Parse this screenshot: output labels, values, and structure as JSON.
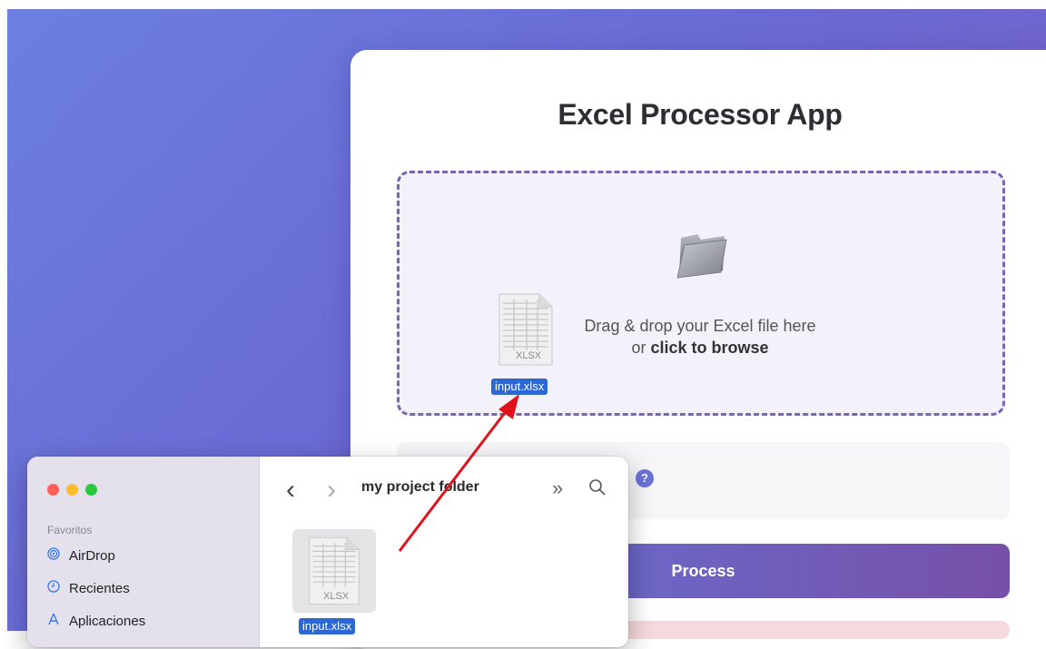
{
  "app": {
    "title": "Excel Processor App",
    "drop_text_line1": "Drag & drop your Excel file here",
    "drop_text_or": "or ",
    "drop_text_browse": "click to browse",
    "help_glyph": "?",
    "process_label": "Process"
  },
  "dragged_file": {
    "name": "input.xlsx",
    "type_label": "XLSX"
  },
  "finder": {
    "folder_title": "my project folder",
    "back_glyph": "‹",
    "forward_glyph": "›",
    "more_glyph": "»",
    "search_glyph": "⌕",
    "sidebar_section": "Favoritos",
    "sidebar_items": [
      {
        "label": "AirDrop",
        "icon": "airdrop-icon"
      },
      {
        "label": "Recientes",
        "icon": "clock-icon"
      },
      {
        "label": "Aplicaciones",
        "icon": "applications-icon"
      }
    ],
    "file": {
      "name": "input.xlsx",
      "type_label": "XLSX"
    }
  },
  "colors": {
    "accent": "#6a72d8",
    "selection": "#2c67d4",
    "arrow": "#e0131d",
    "dropzone_border": "#7c64b4"
  }
}
